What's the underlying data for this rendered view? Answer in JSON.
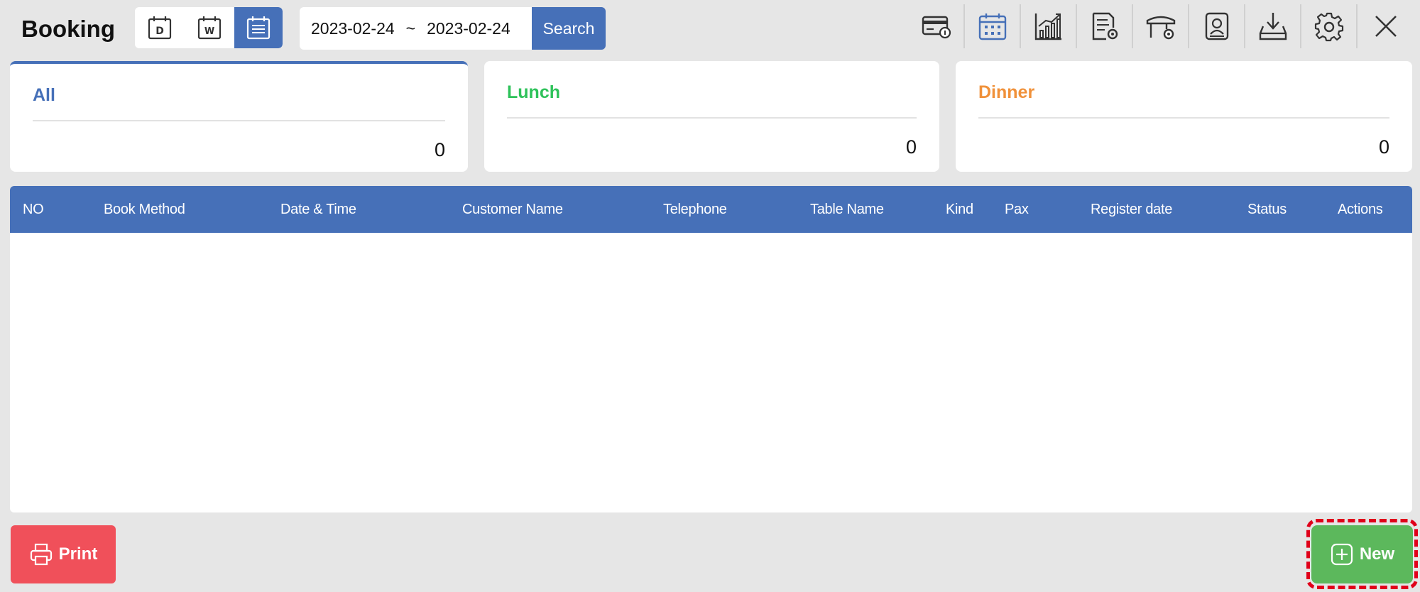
{
  "header": {
    "title": "Booking"
  },
  "view_modes": [
    {
      "name": "day-view",
      "letter": "D"
    },
    {
      "name": "week-view",
      "letter": "W"
    },
    {
      "name": "month-view",
      "letter": ""
    }
  ],
  "date_range": {
    "start": "2023-02-24",
    "separator": "~",
    "end": "2023-02-24"
  },
  "search": {
    "label": "Search"
  },
  "toolbar_icons": [
    "card-payment-icon",
    "calendar-icon",
    "chart-icon",
    "document-settings-icon",
    "table-settings-icon",
    "contact-card-icon",
    "download-icon",
    "gear-icon",
    "close-icon"
  ],
  "summary": {
    "all": {
      "label": "All",
      "value": "0",
      "color": "#4670b8"
    },
    "lunch": {
      "label": "Lunch",
      "value": "0",
      "color": "#2ec25a"
    },
    "dinner": {
      "label": "Dinner",
      "value": "0",
      "color": "#f0913a"
    }
  },
  "table": {
    "columns": [
      "NO",
      "Book Method",
      "Date & Time",
      "Customer Name",
      "Telephone",
      "Table Name",
      "Kind",
      "Pax",
      "Register date",
      "Status",
      "Actions"
    ],
    "rows": []
  },
  "footer": {
    "print_label": "Print",
    "new_label": "New"
  },
  "colors": {
    "accent": "#4670b8",
    "print": "#f0505a",
    "new": "#5cb85c",
    "highlight": "#e0001a"
  }
}
